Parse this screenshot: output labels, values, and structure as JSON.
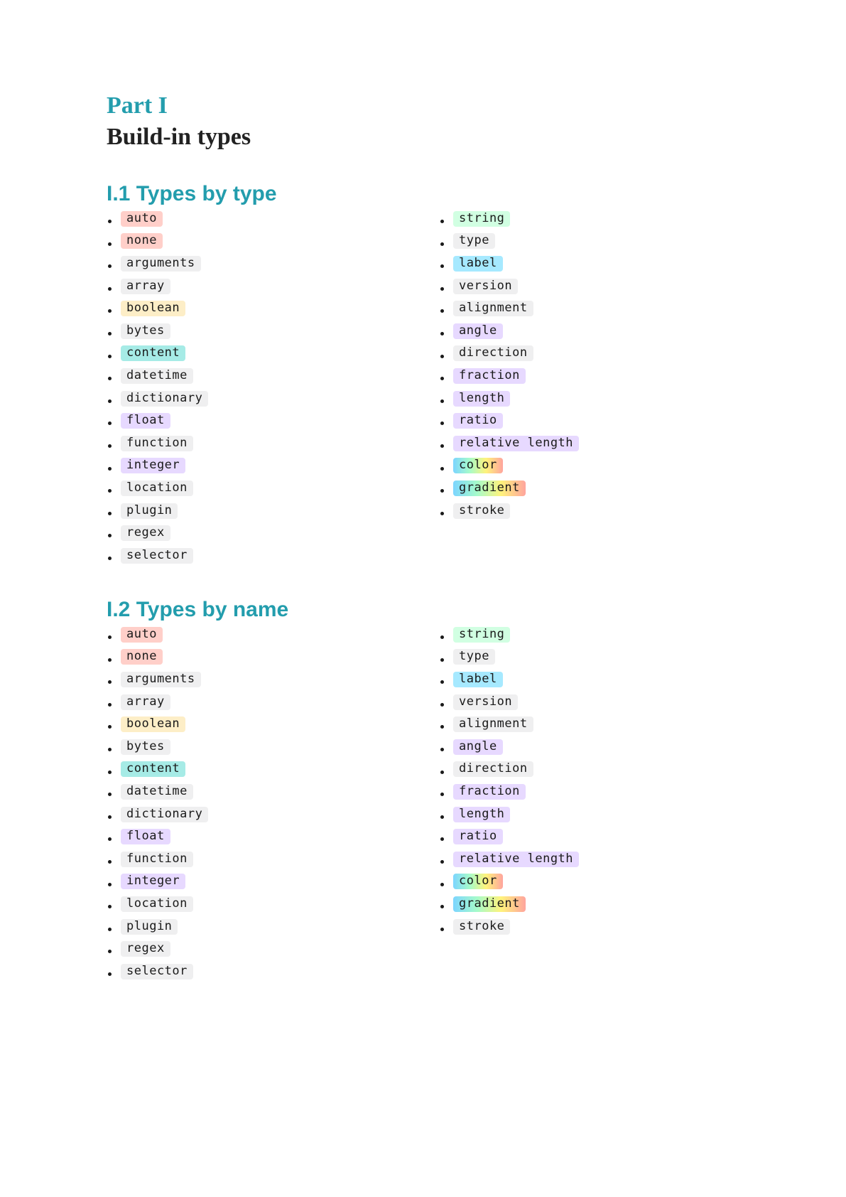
{
  "part": {
    "label": "Part I",
    "title": "Build-in types"
  },
  "colors": {
    "heading": "#239dad",
    "red": "#ffcfc9",
    "yellow": "#fdeec7",
    "teal": "#a6ebe6",
    "purple": "#e7d9ff",
    "green": "#d1ffe2",
    "blue": "#a6e9ff",
    "gray": "#efeff0",
    "rainbow": "rainbow-gradient"
  },
  "sections": [
    {
      "heading": "I.1 Types by type",
      "left": [
        {
          "label": "auto",
          "color": "red"
        },
        {
          "label": "none",
          "color": "red"
        },
        {
          "label": "arguments",
          "color": "gray"
        },
        {
          "label": "array",
          "color": "gray"
        },
        {
          "label": "boolean",
          "color": "yellow"
        },
        {
          "label": "bytes",
          "color": "gray"
        },
        {
          "label": "content",
          "color": "teal"
        },
        {
          "label": "datetime",
          "color": "gray"
        },
        {
          "label": "dictionary",
          "color": "gray"
        },
        {
          "label": "float",
          "color": "purple"
        },
        {
          "label": "function",
          "color": "gray"
        },
        {
          "label": "integer",
          "color": "purple"
        },
        {
          "label": "location",
          "color": "gray"
        },
        {
          "label": "plugin",
          "color": "gray"
        },
        {
          "label": "regex",
          "color": "gray"
        },
        {
          "label": "selector",
          "color": "gray"
        }
      ],
      "right": [
        {
          "label": "string",
          "color": "green"
        },
        {
          "label": "type",
          "color": "gray"
        },
        {
          "label": "label",
          "color": "blue"
        },
        {
          "label": "version",
          "color": "gray"
        },
        {
          "label": "alignment",
          "color": "gray"
        },
        {
          "label": "angle",
          "color": "purple"
        },
        {
          "label": "direction",
          "color": "gray"
        },
        {
          "label": "fraction",
          "color": "purple"
        },
        {
          "label": "length",
          "color": "purple"
        },
        {
          "label": "ratio",
          "color": "purple"
        },
        {
          "label": "relative length",
          "color": "purple"
        },
        {
          "label": "color",
          "color": "rainbow"
        },
        {
          "label": "gradient",
          "color": "rainbow"
        },
        {
          "label": "stroke",
          "color": "gray"
        }
      ]
    },
    {
      "heading": "I.2 Types by name",
      "left": [
        {
          "label": "auto",
          "color": "red"
        },
        {
          "label": "none",
          "color": "red"
        },
        {
          "label": "arguments",
          "color": "gray"
        },
        {
          "label": "array",
          "color": "gray"
        },
        {
          "label": "boolean",
          "color": "yellow"
        },
        {
          "label": "bytes",
          "color": "gray"
        },
        {
          "label": "content",
          "color": "teal"
        },
        {
          "label": "datetime",
          "color": "gray"
        },
        {
          "label": "dictionary",
          "color": "gray"
        },
        {
          "label": "float",
          "color": "purple"
        },
        {
          "label": "function",
          "color": "gray"
        },
        {
          "label": "integer",
          "color": "purple"
        },
        {
          "label": "location",
          "color": "gray"
        },
        {
          "label": "plugin",
          "color": "gray"
        },
        {
          "label": "regex",
          "color": "gray"
        },
        {
          "label": "selector",
          "color": "gray"
        }
      ],
      "right": [
        {
          "label": "string",
          "color": "green"
        },
        {
          "label": "type",
          "color": "gray"
        },
        {
          "label": "label",
          "color": "blue"
        },
        {
          "label": "version",
          "color": "gray"
        },
        {
          "label": "alignment",
          "color": "gray"
        },
        {
          "label": "angle",
          "color": "purple"
        },
        {
          "label": "direction",
          "color": "gray"
        },
        {
          "label": "fraction",
          "color": "purple"
        },
        {
          "label": "length",
          "color": "purple"
        },
        {
          "label": "ratio",
          "color": "purple"
        },
        {
          "label": "relative length",
          "color": "purple"
        },
        {
          "label": "color",
          "color": "rainbow"
        },
        {
          "label": "gradient",
          "color": "rainbow"
        },
        {
          "label": "stroke",
          "color": "gray"
        }
      ]
    }
  ]
}
